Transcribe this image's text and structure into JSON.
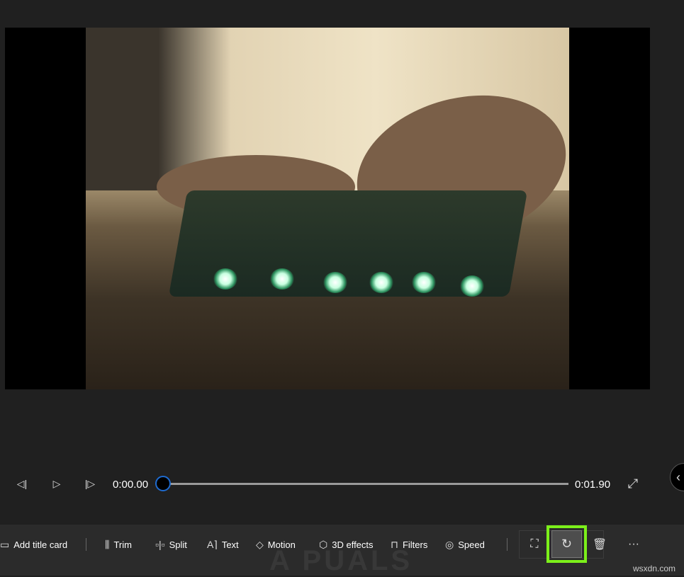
{
  "player": {
    "current_time": "0:00.00",
    "duration": "0:01.90",
    "progress": 0
  },
  "toolbar": {
    "items": [
      {
        "label": "Add title card",
        "icon": "title-card-icon"
      },
      {
        "label": "Trim",
        "icon": "trim-icon"
      },
      {
        "label": "Split",
        "icon": "split-icon"
      },
      {
        "label": "Text",
        "icon": "text-icon"
      },
      {
        "label": "Motion",
        "icon": "motion-icon"
      },
      {
        "label": "3D effects",
        "icon": "3d-effects-icon"
      },
      {
        "label": "Filters",
        "icon": "filters-icon"
      },
      {
        "label": "Speed",
        "icon": "speed-icon"
      }
    ],
    "more": "···",
    "highlight_color": "#7cf01a"
  },
  "watermark": {
    "logo": "APPUALS",
    "site": "wsxdn.com"
  }
}
